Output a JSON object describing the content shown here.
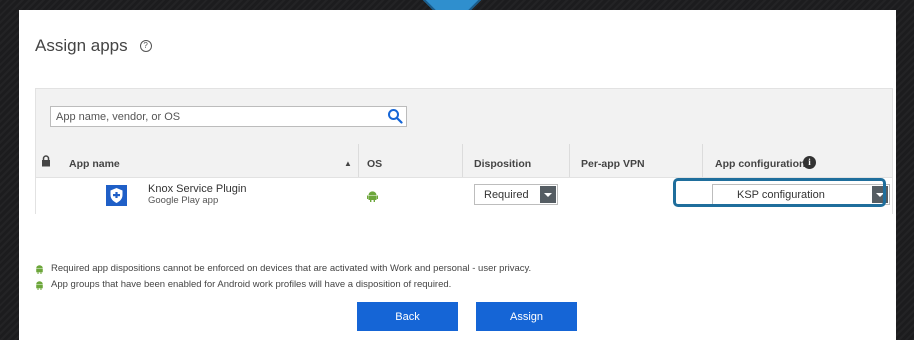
{
  "page": {
    "title": "Assign apps",
    "help_glyph": "?"
  },
  "search": {
    "placeholder": "App name, vendor, or OS"
  },
  "table": {
    "columns": {
      "app_name": "App name",
      "sort_glyph": "▲",
      "os": "OS",
      "disposition": "Disposition",
      "per_app_vpn": "Per-app VPN",
      "app_configuration": "App configuration",
      "info_glyph": "i"
    },
    "rows": [
      {
        "name": "Knox Service Plugin",
        "source": "Google Play app",
        "os_icon": "android-icon",
        "disposition": "Required",
        "per_app_vpn": "",
        "app_configuration": "KSP configuration"
      }
    ]
  },
  "notes": [
    "Required app dispositions cannot be enforced on devices that are activated with Work and personal - user privacy.",
    "App groups that have been enabled for Android work profiles will have a disposition of required."
  ],
  "buttons": {
    "back": "Back",
    "assign": "Assign"
  },
  "colors": {
    "primary": "#1565d6",
    "highlight": "#1f6e9c",
    "android": "#6ca63a",
    "app_icon_bg": "#1f5fc7"
  }
}
